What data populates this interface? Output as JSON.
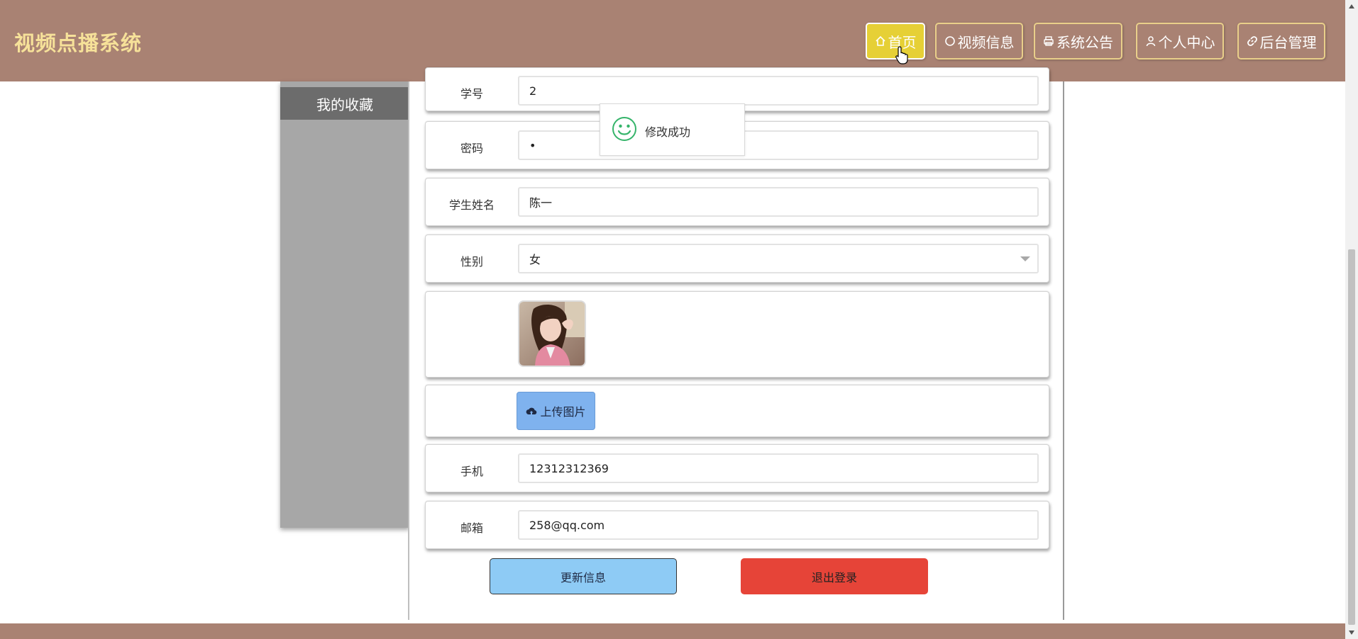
{
  "header": {
    "site_title": "视频点播系统",
    "nav": [
      {
        "label": "首页",
        "icon": "home-icon",
        "active": true
      },
      {
        "label": "视频信息",
        "icon": "circle-icon"
      },
      {
        "label": "系统公告",
        "icon": "printer-icon"
      },
      {
        "label": "个人中心",
        "icon": "user-icon"
      },
      {
        "label": "后台管理",
        "icon": "link-icon"
      }
    ]
  },
  "sidebar": {
    "items": [
      {
        "label": "我的收藏"
      }
    ]
  },
  "form": {
    "student_id": {
      "label": "学号",
      "value": "2"
    },
    "password": {
      "label": "密码",
      "value": "•"
    },
    "name": {
      "label": "学生姓名",
      "value": "陈一"
    },
    "gender": {
      "label": "性别",
      "value": "女"
    },
    "upload_label": "上传图片",
    "phone": {
      "label": "手机",
      "value": "12312312369"
    },
    "email": {
      "label": "邮箱",
      "value": "258@qq.com"
    },
    "update_button": "更新信息",
    "logout_button": "退出登录"
  },
  "toast": {
    "message": "修改成功",
    "icon": "smile-icon"
  },
  "colors": {
    "header_bg": "#a98273",
    "title_color": "#f6e199",
    "active_nav": "#e6d036",
    "update_button": "#8ecbf5",
    "logout_button": "#e64438",
    "sidebar_bg": "#a7a7a7",
    "sidebar_item": "#6c6c6c"
  }
}
